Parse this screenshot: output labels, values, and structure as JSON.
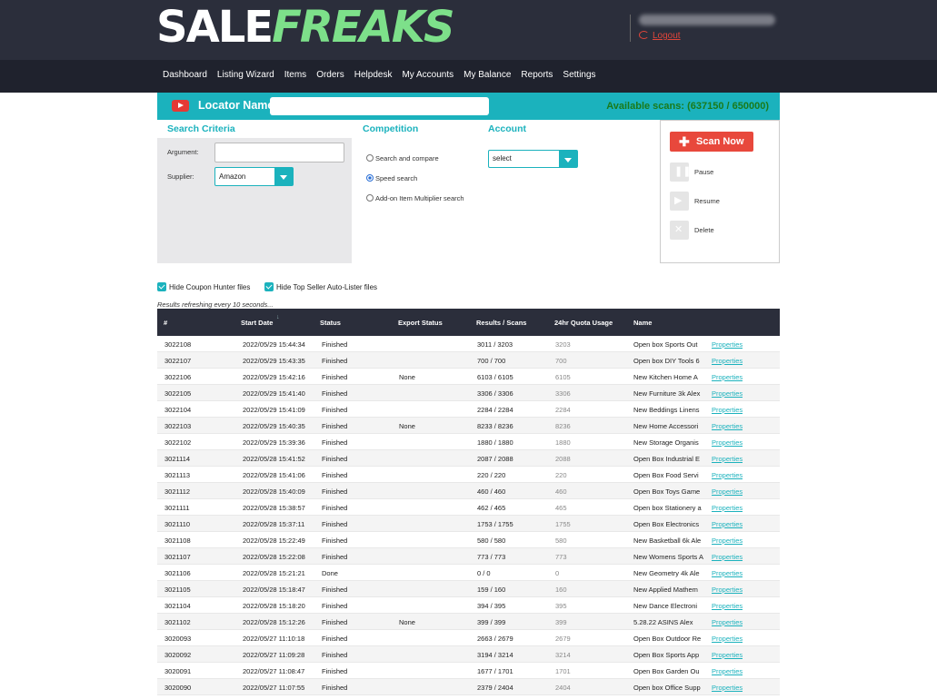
{
  "brand": {
    "logo_part1": "SALE",
    "logo_part2": "FREAKS"
  },
  "user": {
    "logout_label": "Logout"
  },
  "nav": {
    "items": [
      "Dashboard",
      "Listing Wizard",
      "Items",
      "Orders",
      "Helpdesk",
      "My Accounts",
      "My Balance",
      "Reports",
      "Settings"
    ]
  },
  "locator": {
    "label": "Locator Name",
    "value": "",
    "available_scans": "Available scans: (637150 / 650000)"
  },
  "search_criteria": {
    "heading": "Search Criteria",
    "argument_label": "Argument:",
    "argument_value": "",
    "supplier_label": "Supplier:",
    "supplier_value": "Amazon"
  },
  "competition": {
    "heading": "Competition",
    "options": [
      "Search and compare",
      "Speed search",
      "Add-on Item Multiplier search"
    ],
    "selected_index": 1
  },
  "account": {
    "heading": "Account",
    "value": "select"
  },
  "controls": {
    "scan_now": "Scan Now",
    "pause": "Pause",
    "resume": "Resume",
    "delete": "Delete"
  },
  "filters": {
    "hide_coupon": "Hide Coupon Hunter files",
    "hide_top_seller": "Hide Top Seller Auto-Lister files",
    "hide_coupon_checked": true,
    "hide_top_seller_checked": true
  },
  "refresh_text": "Results refreshing every 10 seconds...",
  "table": {
    "columns": [
      "#",
      "Start Date",
      "Status",
      "Export Status",
      "Results / Scans",
      "24hr Quota Usage",
      "Name"
    ],
    "properties_label": "Properties",
    "rows": [
      [
        "3022108",
        "2022/05/29 15:44:34",
        "Finished",
        "",
        "3011 / 3203",
        "3203",
        "Open box Sports  Out"
      ],
      [
        "3022107",
        "2022/05/29 15:43:35",
        "Finished",
        "",
        "700 / 700",
        "700",
        "Open box DIY  Tools 6"
      ],
      [
        "3022106",
        "2022/05/29 15:42:16",
        "Finished",
        "None",
        "6103 / 6105",
        "6105",
        "New Kitchen  Home A"
      ],
      [
        "3022105",
        "2022/05/29 15:41:40",
        "Finished",
        "",
        "3306 / 3306",
        "3306",
        "New Furniture 3k Alex"
      ],
      [
        "3022104",
        "2022/05/29 15:41:09",
        "Finished",
        "",
        "2284 / 2284",
        "2284",
        "New Beddings  Linens"
      ],
      [
        "3022103",
        "2022/05/29 15:40:35",
        "Finished",
        "None",
        "8233 / 8236",
        "8236",
        "New Home Accessori"
      ],
      [
        "3022102",
        "2022/05/29 15:39:36",
        "Finished",
        "",
        "1880 / 1880",
        "1880",
        "New Storage  Organis"
      ],
      [
        "3021114",
        "2022/05/28 15:41:52",
        "Finished",
        "",
        "2087 / 2088",
        "2088",
        "Open Box Industrial E"
      ],
      [
        "3021113",
        "2022/05/28 15:41:06",
        "Finished",
        "",
        "220 / 220",
        "220",
        "Open Box Food Servi"
      ],
      [
        "3021112",
        "2022/05/28 15:40:09",
        "Finished",
        "",
        "460 / 460",
        "460",
        "Open Box Toys  Game"
      ],
      [
        "3021111",
        "2022/05/28 15:38:57",
        "Finished",
        "",
        "462 / 465",
        "465",
        "Open box Stationery a"
      ],
      [
        "3021110",
        "2022/05/28 15:37:11",
        "Finished",
        "",
        "1753 / 1755",
        "1755",
        "Open Box Electronics"
      ],
      [
        "3021108",
        "2022/05/28 15:22:49",
        "Finished",
        "",
        "580 / 580",
        "580",
        "New Basketball 6k Ale"
      ],
      [
        "3021107",
        "2022/05/28 15:22:08",
        "Finished",
        "",
        "773 / 773",
        "773",
        "New Womens Sports A"
      ],
      [
        "3021106",
        "2022/05/28 15:21:21",
        " Done",
        "",
        "0 / 0",
        "0",
        "New Geometry 4k Ale"
      ],
      [
        "3021105",
        "2022/05/28 15:18:47",
        "Finished",
        "",
        "159 / 160",
        "160",
        "New Applied Mathem"
      ],
      [
        "3021104",
        "2022/05/28 15:18:20",
        "Finished",
        "",
        "394 / 395",
        "395",
        "New Dance  Electroni"
      ],
      [
        "3021102",
        "2022/05/28 15:12:26",
        "Finished",
        "None",
        "399 / 399",
        "399",
        "5.28.22 ASINS Alex"
      ],
      [
        "3020093",
        "2022/05/27 11:10:18",
        "Finished",
        "",
        "2663 / 2679",
        "2679",
        "Open Box Outdoor Re"
      ],
      [
        "3020092",
        "2022/05/27 11:09:28",
        "Finished",
        "",
        "3194 / 3214",
        "3214",
        "Open Box Sports App"
      ],
      [
        "3020091",
        "2022/05/27 11:08:47",
        "Finished",
        "",
        "1677 / 1701",
        "1701",
        "Open Box Garden  Ou"
      ],
      [
        "3020090",
        "2022/05/27 11:07:55",
        "Finished",
        "",
        "2379 / 2404",
        "2404",
        "Open box Office Supp"
      ]
    ]
  }
}
